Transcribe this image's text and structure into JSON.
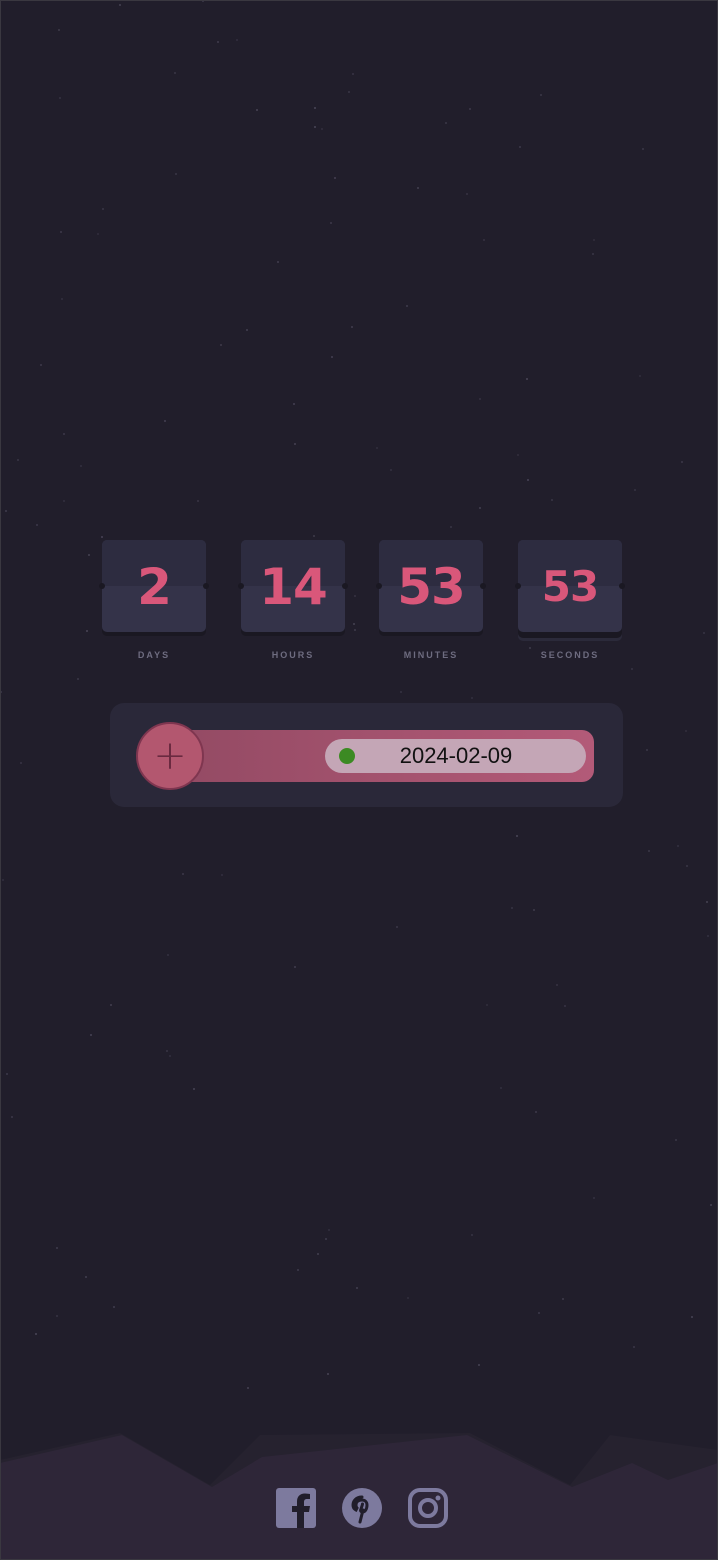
{
  "countdown": {
    "units": [
      {
        "value": "2",
        "label": "DAYS"
      },
      {
        "value": "14",
        "label": "HOURS"
      },
      {
        "value": "53",
        "label": "MINUTES"
      },
      {
        "value": "53",
        "label": "SECONDS"
      }
    ]
  },
  "date_control": {
    "add_icon": "plus-icon",
    "date_value": "2024-02-09",
    "status_dot_color": "#3c8a23"
  },
  "social": {
    "icons": [
      "facebook-icon",
      "pinterest-icon",
      "instagram-icon"
    ]
  },
  "colors": {
    "background": "#211e2b",
    "accent": "#d9577a",
    "card": "#343349",
    "icon": "#7d7a9e"
  }
}
